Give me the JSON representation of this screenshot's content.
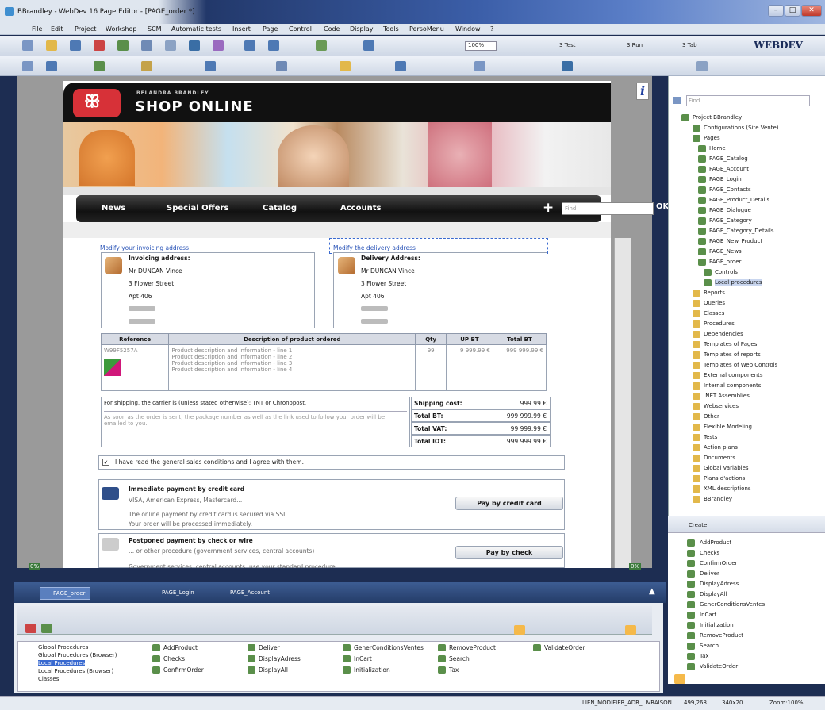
{
  "window": {
    "title": "BBrandley - WebDev 16 Page Editor - [PAGE_order *]"
  },
  "menu": [
    "File",
    "Edit",
    "Project",
    "Workshop",
    "SCM",
    "Automatic tests",
    "Insert",
    "Page",
    "Control",
    "Code",
    "Display",
    "Tools",
    "PersoMenu",
    "Window",
    "?"
  ],
  "toolbar": {
    "zoom": "100%",
    "brand": "WEBDEV",
    "tests": [
      "3 Test",
      "3 Run",
      "3 Tab"
    ]
  },
  "shop": {
    "brand_small": "BELANDRA BRANDLEY",
    "title": "SHOP ONLINE",
    "logo_glyph": "ꕥ",
    "nav": [
      "News",
      "Special Offers",
      "Catalog",
      "Accounts"
    ],
    "search_placeholder": "Find",
    "ok": "OK"
  },
  "order": {
    "invoice_link": "Modify your invoicing address",
    "delivery_link": "Modify the delivery address",
    "invoicing": {
      "heading": "Invoicing address:",
      "lines": [
        "Mr DUNCAN Vince",
        "3 Flower Street",
        "Apt 406"
      ]
    },
    "delivery": {
      "heading": "Delivery Address:",
      "lines": [
        "Mr DUNCAN Vince",
        "3 Flower Street",
        "Apt 406"
      ]
    },
    "columns": [
      "Reference",
      "Description of product ordered",
      "Qty",
      "UP BT",
      "Total BT"
    ],
    "row": {
      "ref": "W99F5257A",
      "desc": [
        "Product description and information - line 1",
        "Product description and information - line 2",
        "Product description and information - line 3",
        "Product description and information - line 4"
      ],
      "qty": "99",
      "up": "9 999.99 €",
      "total": "999 999.99 €"
    },
    "shipping_note": "For shipping, the carrier is (unless stated otherwise): TNT or Chronopost.",
    "shipping_note2": "As soon as the order is sent, the package number as well as the link used to follow your order will be emailed to you.",
    "totals": [
      {
        "label": "Shipping cost:",
        "value": "999.99 €"
      },
      {
        "label": "Total BT:",
        "value": "999 999.99 €"
      },
      {
        "label": "Total VAT:",
        "value": "99 999.99 €"
      },
      {
        "label": "Total IOT:",
        "value": "999 999.99 €"
      }
    ],
    "agree": "I have read the general sales conditions and I agree with them.",
    "pay1": {
      "title": "Immediate payment by credit card",
      "sub": "VISA, American Express, Mastercard...",
      "l1": "The online payment by credit card is secured via SSL.",
      "l2": "Your order will be processed immediately.",
      "button": "Pay by credit card"
    },
    "pay2": {
      "title": "Postponed payment by check or wire",
      "sub": "... or other procedure (government services, central accounts)",
      "l1": "Government services, central accounts: use your standard procedure.",
      "button": "Pay by check"
    }
  },
  "explorer": {
    "search": "Find",
    "items": [
      "Project BBrandley",
      "Configurations (Site Vente)",
      "Pages",
      "Home",
      "PAGE_Catalog",
      "PAGE_Account",
      "PAGE_Login",
      "PAGE_Contacts",
      "PAGE_Product_Details",
      "PAGE_Dialogue",
      "PAGE_Category",
      "PAGE_Category_Details",
      "PAGE_New_Product",
      "PAGE_News",
      "PAGE_order",
      "Controls",
      "Local procedures",
      "Reports",
      "Queries",
      "Classes",
      "Procedures",
      "Dependencies",
      "Templates of Pages",
      "Templates of reports",
      "Templates of Web Controls",
      "External components",
      "Internal components",
      ".NET Assemblies",
      "Webservices",
      "Other",
      "Flexible Modeling",
      "Tests",
      "Action plans",
      "Documents",
      "Global Variables",
      "Plans d'actions",
      "XML descriptions",
      "BBrandley"
    ]
  },
  "create_label": "Create",
  "procs": [
    "AddProduct",
    "Checks",
    "ConfirmOrder",
    "Deliver",
    "DisplayAdress",
    "DisplayAll",
    "GenerConditionsVentes",
    "InCart",
    "Initialization",
    "RemoveProduct",
    "Search",
    "Tax",
    "ValidateOrder"
  ],
  "tabs": [
    "PAGE_order",
    "PAGE_Login",
    "PAGE_Account"
  ],
  "proc_cats": [
    "Global Procedures",
    "Global Procedures (Browser)",
    "Local Procedures",
    "Local Procedures (Browser)",
    "Classes"
  ],
  "grid": [
    "AddProduct",
    "Checks",
    "ConfirmOrder",
    "Deliver",
    "DisplayAdress",
    "DisplayAll",
    "GenerConditionsVentes",
    "InCart",
    "Initialization",
    "RemoveProduct",
    "Search",
    "Tax",
    "ValidateOrder"
  ],
  "status": {
    "ctrl": "LIEN_MODIFIER_ADR_LIVRAISON",
    "pos": "499,268",
    "size": "340x20",
    "zoom": "Zoom:100%"
  },
  "ruler": {
    "left": "0%",
    "right": "0%"
  },
  "panel_icon": "i"
}
